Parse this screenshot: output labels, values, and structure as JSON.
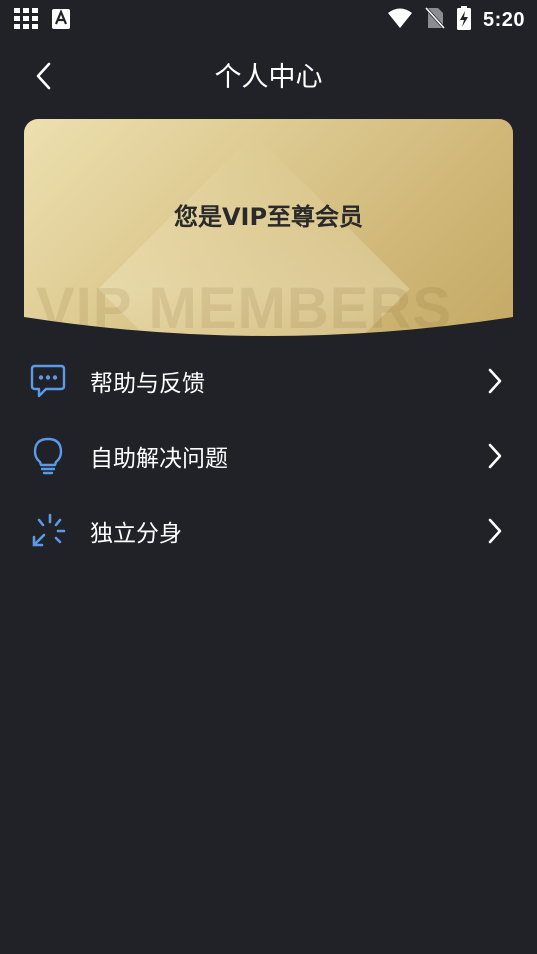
{
  "status_bar": {
    "time": "5:20",
    "left_icons": [
      "grid-icon",
      "text-a-icon"
    ],
    "right_icons": [
      "wifi-icon",
      "no-sim-icon",
      "battery-charging-icon"
    ]
  },
  "header": {
    "title": "个人中心",
    "back_icon": "back-arrow-icon"
  },
  "vip_card": {
    "title": "您是VIP至尊会员",
    "watermark": "VIP MEMBERS",
    "gradient_colors": [
      "#ede0b0",
      "#c4a964"
    ]
  },
  "menu": {
    "items": [
      {
        "label": "帮助与反馈",
        "icon": "chat-bubble-icon"
      },
      {
        "label": "自助解决问题",
        "icon": "lightbulb-icon"
      },
      {
        "label": "独立分身",
        "icon": "burst-arrow-icon"
      }
    ]
  },
  "colors": {
    "background": "#202227",
    "icon_accent": "#5b9ae8",
    "text": "#ffffff"
  }
}
